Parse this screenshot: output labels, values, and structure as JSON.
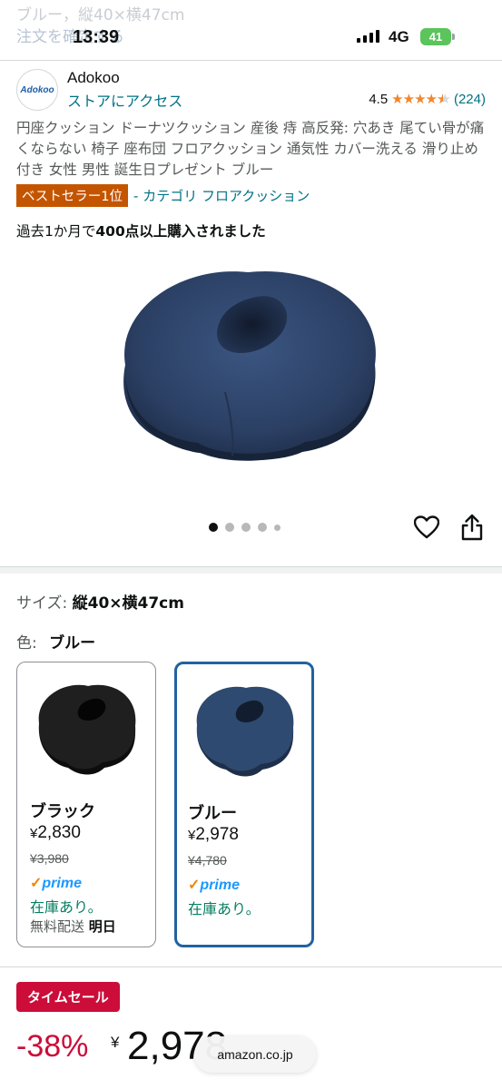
{
  "ghost_text": {
    "line1": "ブルー，縦40×横47cm",
    "line2": "注文を確定する"
  },
  "status_bar": {
    "time": "13:39",
    "network": "4G",
    "battery": "41"
  },
  "brand": {
    "logo_text": "Adokoo",
    "name": "Adokoo",
    "store_link": "ストアにアクセス",
    "rating_value": "4.5",
    "rating_stars": 4.5,
    "rating_count": "(224)"
  },
  "product": {
    "title": "円座クッション ドーナツクッション 産後 痔 高反発: 穴あき 尾てい骨が痛くならない 椅子 座布団 フロアクッション 通気性 カバー洗える 滑り止め付き 女性 男性 誕生日プレゼント ブルー",
    "badge": "ベストセラー1位",
    "category": "- カテゴリ フロアクッション",
    "bought_prefix": "過去1か月で",
    "bought_bold": "400点以上購入されました",
    "image_index": 1,
    "image_count": 5
  },
  "options": {
    "size_label": "サイズ:",
    "size_value": "縦40×横47cm",
    "color_label": "色:",
    "color_value": "ブルー"
  },
  "variants": [
    {
      "name": "ブラック",
      "currency": "¥",
      "price": "2,830",
      "old_price": "¥3,980",
      "prime_check": "✓",
      "prime": "prime",
      "stock": "在庫あり。",
      "shipping_label": "無料配送",
      "shipping_day": "明日",
      "swatch_color": "#1f1f1f"
    },
    {
      "name": "ブルー",
      "currency": "¥",
      "price": "2,978",
      "old_price": "¥4,780",
      "prime_check": "✓",
      "prime": "prime",
      "stock": "在庫あり。",
      "swatch_color": "#2f4a70"
    }
  ],
  "deal": {
    "label": "タイムセール",
    "discount": "-38%",
    "currency": "¥",
    "price": "2,978"
  },
  "browser": {
    "url": "amazon.co.jp"
  },
  "colors": {
    "link": "#007185",
    "badge": "#c45500",
    "deal": "#cc0c39",
    "selected_border": "#2162a1",
    "stars": "#f1862a",
    "in_stock": "#067d62"
  }
}
